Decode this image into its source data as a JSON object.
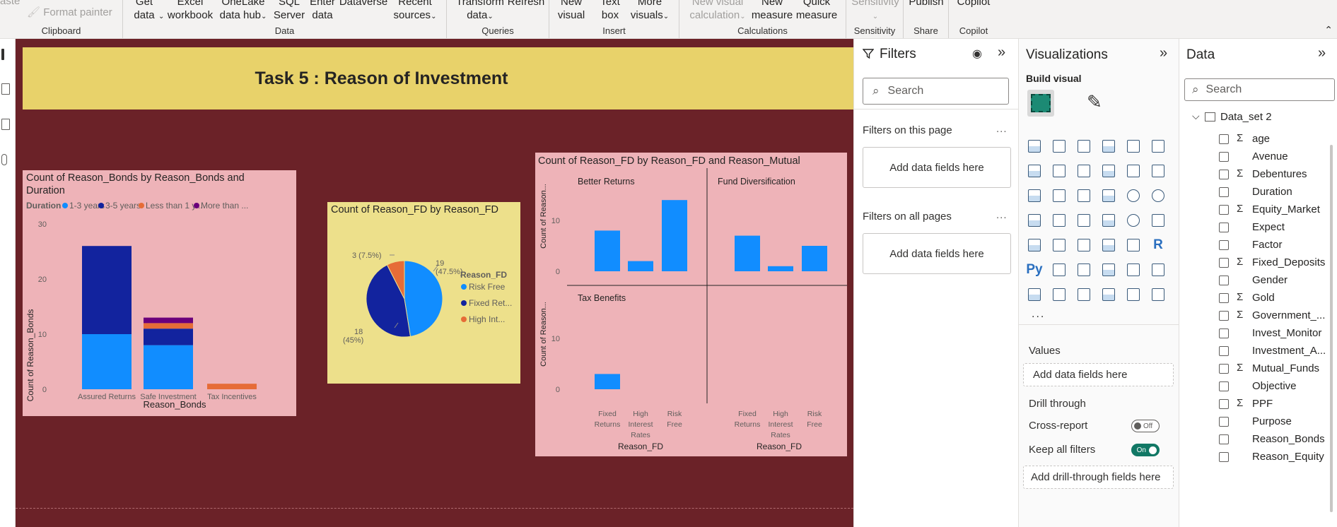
{
  "ribbon": {
    "groups": [
      {
        "label": "Clipboard",
        "buttons": [
          {
            "text": "Format painter",
            "disabled": true
          }
        ]
      },
      {
        "label": "Data",
        "buttons": [
          {
            "text": "Get data"
          },
          {
            "text": "Excel workbook"
          },
          {
            "text": "OneLake data hub"
          },
          {
            "text": "SQL Server"
          },
          {
            "text": "Enter data"
          },
          {
            "text": "Dataverse"
          },
          {
            "text": "Recent sources"
          }
        ]
      },
      {
        "label": "Queries",
        "buttons": [
          {
            "text": "Transform data"
          },
          {
            "text": "Refresh"
          }
        ]
      },
      {
        "label": "Insert",
        "buttons": [
          {
            "text": "New visual"
          },
          {
            "text": "Text box"
          },
          {
            "text": "More visuals"
          }
        ]
      },
      {
        "label": "Calculations",
        "buttons": [
          {
            "text": "New visual calculation",
            "disabled": true
          },
          {
            "text": "New measure"
          },
          {
            "text": "Quick measure"
          }
        ]
      },
      {
        "label": "Sensitivity",
        "buttons": [
          {
            "text": "Sensitivity",
            "disabled": true
          }
        ]
      },
      {
        "label": "Share",
        "buttons": [
          {
            "text": "Publish"
          }
        ]
      },
      {
        "label": "Copilot",
        "buttons": [
          {
            "text": "Copilot"
          }
        ]
      }
    ],
    "paste_fragment": "aste"
  },
  "report": {
    "title": "Task 5 : Reason  of Investment",
    "colors": {
      "canvas": "#6b2228",
      "banner": "#e8d26a",
      "pink_visual": "#eeb3b8",
      "yellow_visual": "#ede08b"
    }
  },
  "visual1": {
    "title_line1": "Count of Reason_Bonds by Reason_Bonds and",
    "title_line2": "Duration",
    "legend_title": "Duration",
    "legend": [
      {
        "name": "1-3 years",
        "color": "#118dff"
      },
      {
        "name": "3-5 years",
        "color": "#12239e"
      },
      {
        "name": "Less than 1 y...",
        "color": "#e66c37"
      },
      {
        "name": "More than ...",
        "color": "#6b007b"
      }
    ],
    "ylabel": "Count of Reason_Bonds",
    "xlabel": "Reason_Bonds",
    "yticks": [
      "30",
      "20",
      "10",
      "0"
    ]
  },
  "visual2": {
    "title": "Count of Reason_FD by Reason_FD",
    "legend_title": "Reason_FD",
    "legend": [
      {
        "name": "Risk Free",
        "color": "#118dff"
      },
      {
        "name": "Fixed Ret...",
        "color": "#12239e"
      },
      {
        "name": "High Int...",
        "color": "#e66c37"
      }
    ],
    "labels": {
      "a_count": "19",
      "a_pct": "(47.5%)",
      "b_count": "18",
      "b_pct": "(45%)",
      "c": "3 (7.5%)"
    }
  },
  "visual3": {
    "title": "Count of Reason_FD by Reason_FD and Reason_Mutual",
    "panels": [
      "Better Returns",
      "Fund Diversification",
      "Tax Benefits"
    ],
    "ylabel": "Count of Reason...",
    "xlabel": "Reason_FD",
    "yticks": [
      "10",
      "0"
    ],
    "xcats": [
      [
        "Fixed",
        "Returns"
      ],
      [
        "High",
        "Interest",
        "Rates"
      ],
      [
        "Risk",
        "Free"
      ]
    ]
  },
  "chart_data": [
    {
      "type": "bar",
      "title": "Count of Reason_Bonds by Reason_Bonds and Duration",
      "xlabel": "Reason_Bonds",
      "ylabel": "Count of Reason_Bonds",
      "ylim": [
        0,
        30
      ],
      "categories": [
        "Assured Returns",
        "Safe Investment",
        "Tax Incentives"
      ],
      "series": [
        {
          "name": "1-3 years",
          "values": [
            10,
            8,
            0
          ]
        },
        {
          "name": "3-5 years",
          "values": [
            16,
            3,
            0
          ]
        },
        {
          "name": "Less than 1 y...",
          "values": [
            0,
            1,
            1
          ]
        },
        {
          "name": "More than ...",
          "values": [
            0,
            1,
            0
          ]
        }
      ],
      "stacked": true,
      "legend_position": "top"
    },
    {
      "type": "pie",
      "title": "Count of Reason_FD by Reason_FD",
      "categories": [
        "Risk Free",
        "Fixed Ret...",
        "High Int..."
      ],
      "values": [
        19,
        18,
        3
      ],
      "legend_position": "right"
    },
    {
      "type": "bar",
      "title": "Count of Reason_FD by Reason_FD and Reason_Mutual",
      "xlabel": "Reason_FD",
      "ylabel": "Count of Reason...",
      "ylim": [
        0,
        15
      ],
      "categories": [
        "Fixed Returns",
        "High Interest Rates",
        "Risk Free"
      ],
      "series": [
        {
          "name": "Better Returns",
          "values": [
            8,
            2,
            14
          ]
        },
        {
          "name": "Fund Diversification",
          "values": [
            7,
            1,
            5
          ]
        },
        {
          "name": "Tax Benefits",
          "values": [
            3,
            0,
            0
          ]
        }
      ]
    }
  ],
  "filters": {
    "title": "Filters",
    "search_placeholder": "Search",
    "on_page": "Filters on this page",
    "on_all": "Filters on all pages",
    "add": "Add data fields here",
    "dots": "..."
  },
  "viz": {
    "title": "Visualizations",
    "build_visual": "Build visual",
    "more": "...",
    "values": "Values",
    "values_add": "Add data fields here",
    "drill_through": "Drill through",
    "cross_report": "Cross-report",
    "cross_state": "Off",
    "keep_filters": "Keep all filters",
    "keep_state": "On",
    "drill_add": "Add drill-through fields here",
    "r_label": "R",
    "py_label": "Py"
  },
  "data_pane": {
    "title": "Data",
    "search_placeholder": "Search",
    "table": "Data_set 2",
    "fields": [
      {
        "name": "age",
        "sigma": true
      },
      {
        "name": "Avenue",
        "sigma": false
      },
      {
        "name": "Debentures",
        "sigma": true
      },
      {
        "name": "Duration",
        "sigma": false
      },
      {
        "name": "Equity_Market",
        "sigma": true
      },
      {
        "name": "Expect",
        "sigma": false
      },
      {
        "name": "Factor",
        "sigma": false
      },
      {
        "name": "Fixed_Deposits",
        "sigma": true
      },
      {
        "name": "Gender",
        "sigma": false
      },
      {
        "name": "Gold",
        "sigma": true
      },
      {
        "name": "Government_...",
        "sigma": true
      },
      {
        "name": "Invest_Monitor",
        "sigma": false
      },
      {
        "name": "Investment_A...",
        "sigma": false
      },
      {
        "name": "Mutual_Funds",
        "sigma": true
      },
      {
        "name": "Objective",
        "sigma": false
      },
      {
        "name": "PPF",
        "sigma": true
      },
      {
        "name": "Purpose",
        "sigma": false
      },
      {
        "name": "Reason_Bonds",
        "sigma": false
      },
      {
        "name": "Reason_Equity",
        "sigma": false
      }
    ]
  }
}
